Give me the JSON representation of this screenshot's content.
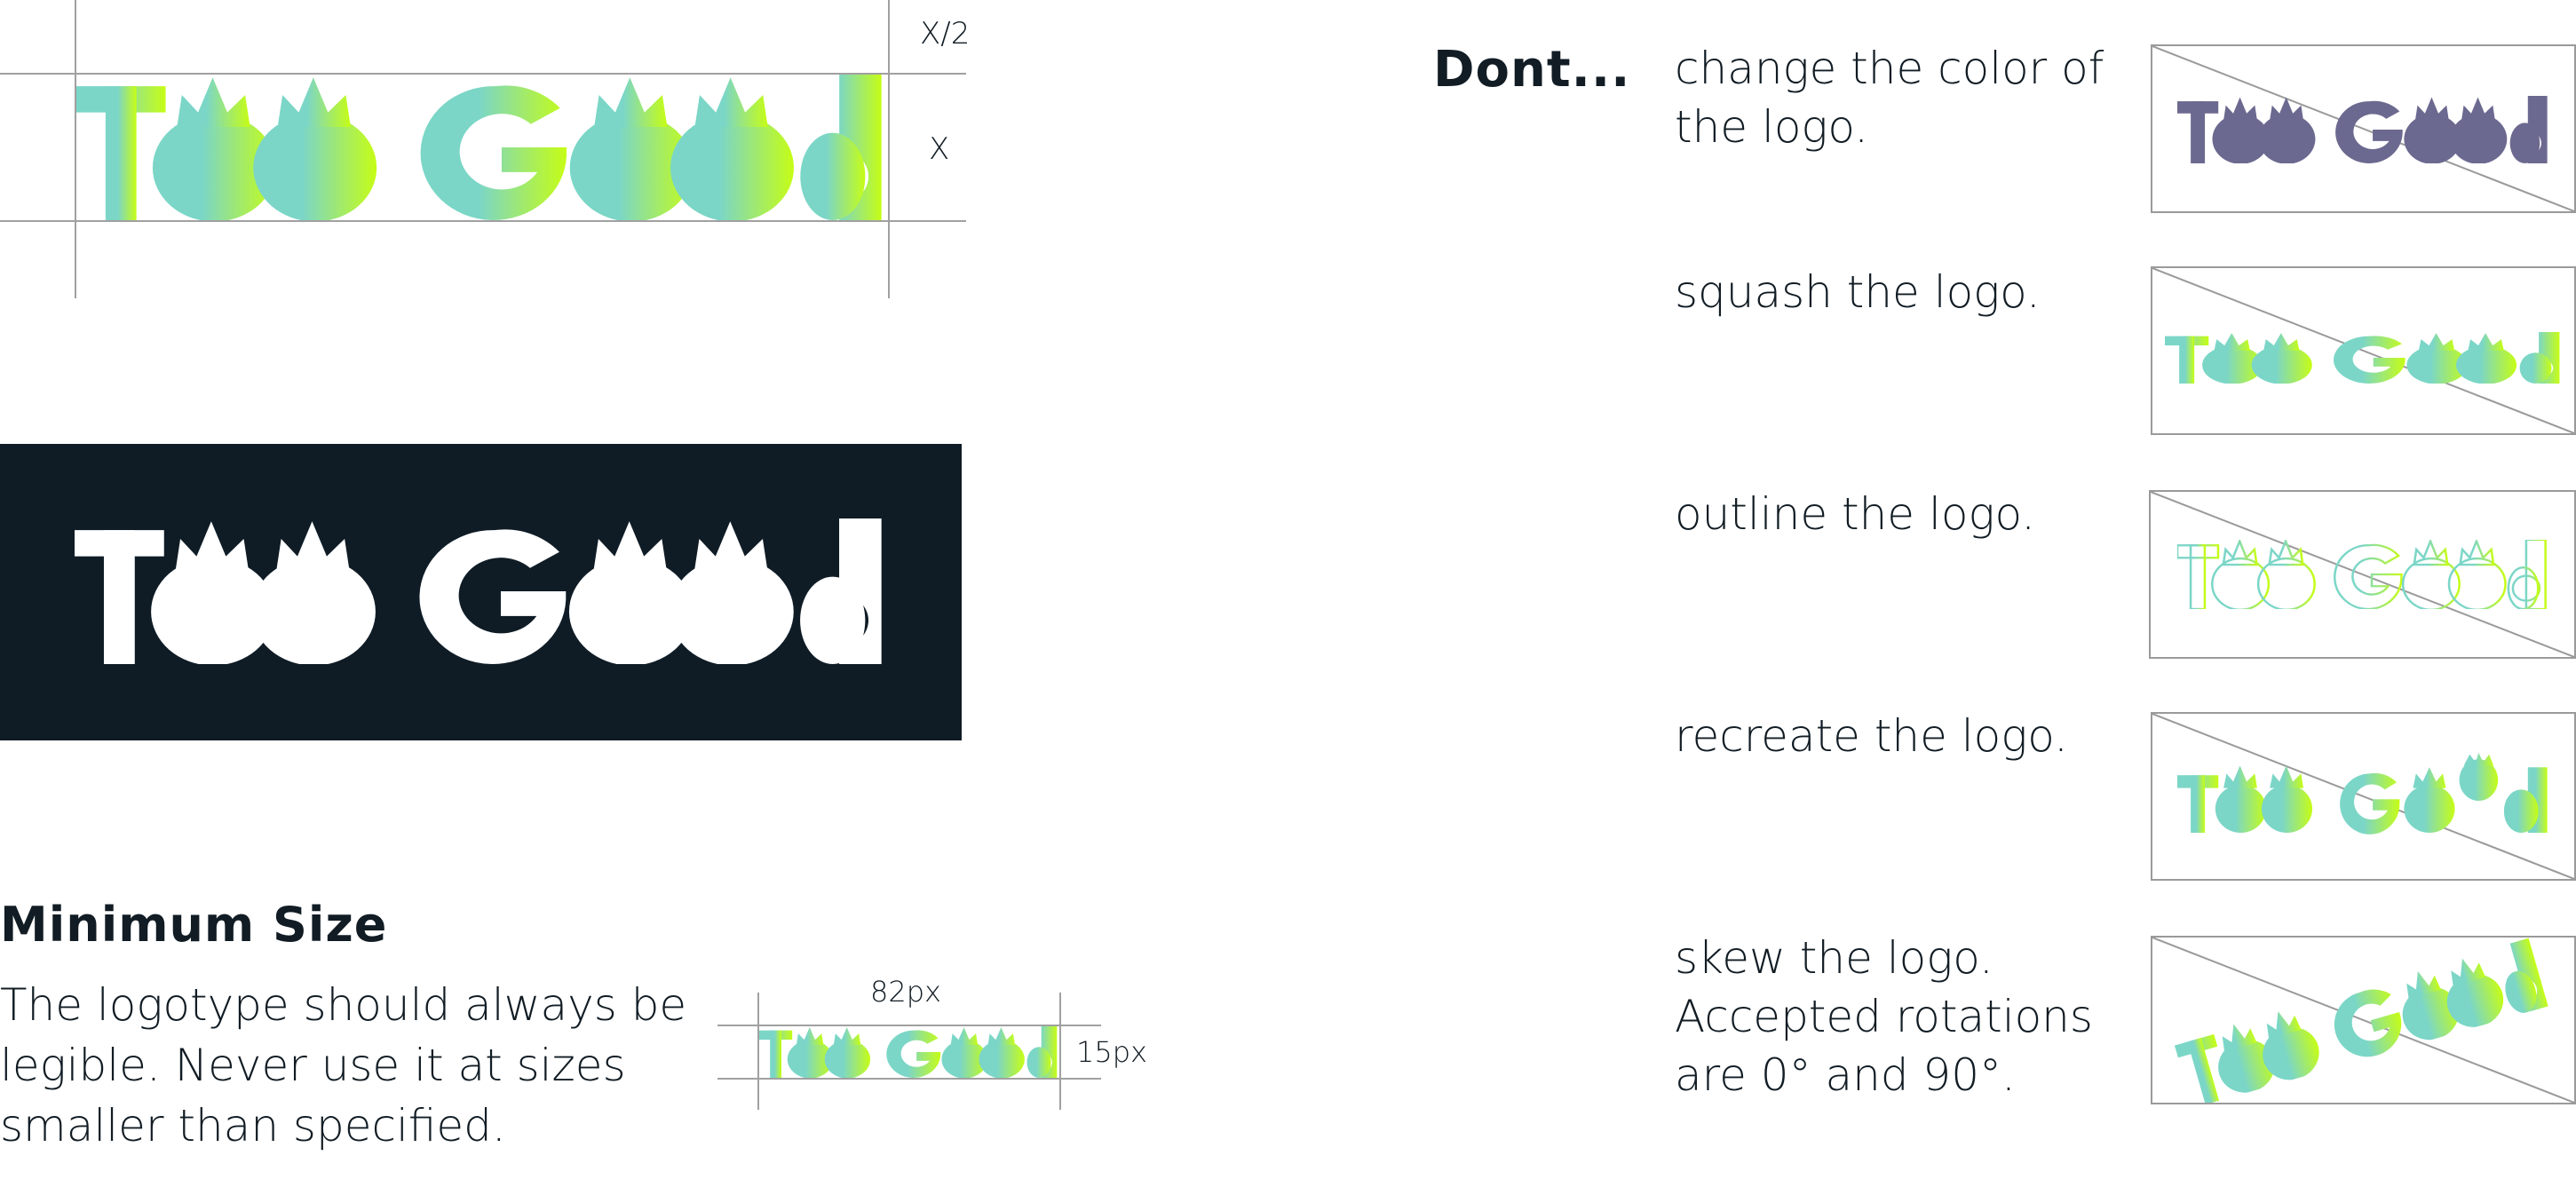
{
  "logo": {
    "text_part1": "Too",
    "text_part2": "Good"
  },
  "construction": {
    "label_half": "X/2",
    "label_full": "X"
  },
  "colors": {
    "teal": "#7bd6c7",
    "lime": "#c6fd15",
    "navy": "#0f1c26",
    "purple": "#6c6990",
    "white": "#ffffff"
  },
  "minimum_size": {
    "heading": "Minimum Size",
    "body_lines": [
      "The logotype should always be",
      "legible. Never use it at sizes",
      "smaller than specified."
    ],
    "width_label": "82px",
    "height_label": "15px"
  },
  "donts": {
    "heading": "Dont...",
    "items": [
      {
        "lines": [
          "change the color of",
          "the logo."
        ]
      },
      {
        "lines": [
          "squash the logo."
        ]
      },
      {
        "lines": [
          "outline the logo."
        ]
      },
      {
        "lines": [
          "recreate the logo."
        ]
      },
      {
        "lines": [
          "skew the logo.",
          "Accepted rotations",
          "are 0° and 90°."
        ]
      }
    ]
  }
}
